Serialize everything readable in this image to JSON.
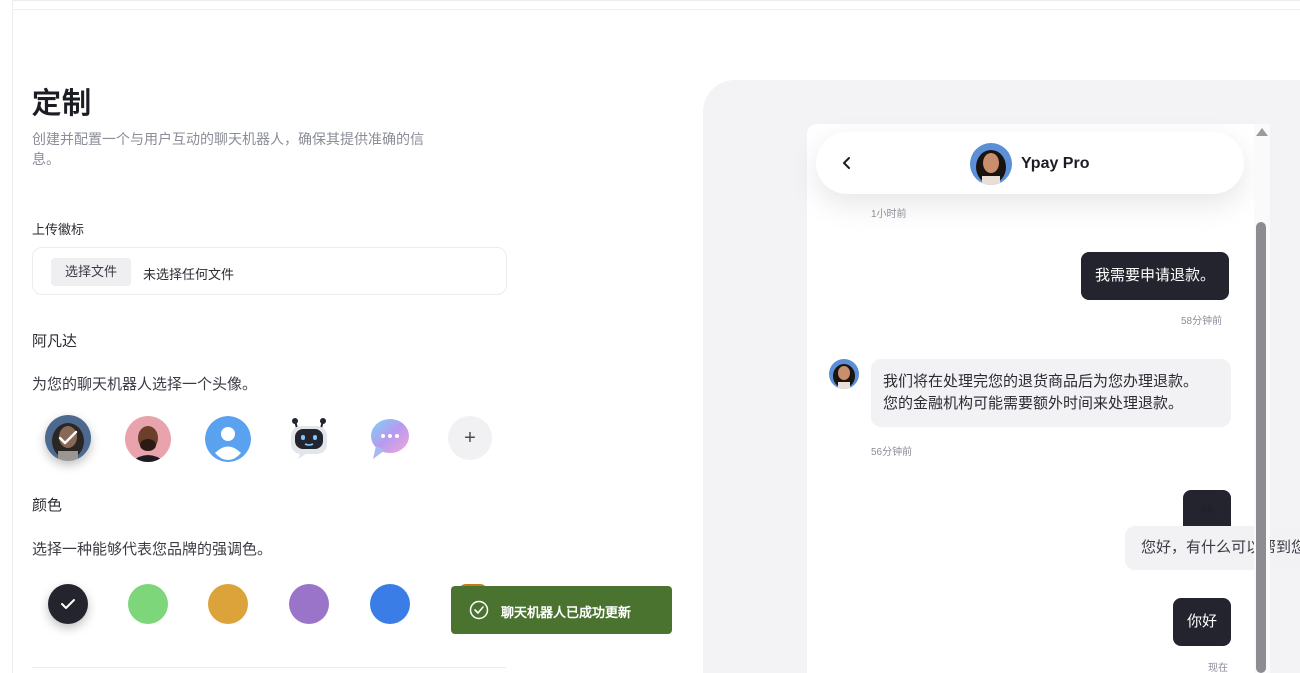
{
  "page": {
    "title": "定制",
    "subtitle": "创建并配置一个与用户互动的聊天机器人，确保其提供准确的信息。"
  },
  "logo_upload": {
    "label": "上传徽标",
    "button_label": "选择文件",
    "file_status": "未选择任何文件"
  },
  "avatar_section": {
    "label": "阿凡达",
    "description": "为您的聊天机器人选择一个头像。",
    "add_label": "+",
    "items": [
      {
        "name": "woman-photo",
        "selected": true
      },
      {
        "name": "man-photo",
        "selected": false
      },
      {
        "name": "default-user-icon",
        "selected": false
      },
      {
        "name": "robot-icon",
        "selected": false
      },
      {
        "name": "chat-bubble-icon",
        "selected": false
      }
    ]
  },
  "color_section": {
    "label": "颜色",
    "description": "选择一种能够代表您品牌的强调色。",
    "swatches": [
      {
        "color": "#24242f",
        "selected": true
      },
      {
        "color": "#7dd67a",
        "selected": false
      },
      {
        "color": "#dba33a",
        "selected": false
      },
      {
        "color": "#9a74c9",
        "selected": false
      },
      {
        "color": "#3a7de6",
        "selected": false
      }
    ]
  },
  "toast": {
    "message": "聊天机器人已成功更新",
    "color": "#4a7330"
  },
  "preview": {
    "bot_name": "Ypay Pro",
    "messages": [
      {
        "role": "time",
        "text": "1小时前"
      },
      {
        "role": "user",
        "text": "我需要申请退款。",
        "time": "58分钟前"
      },
      {
        "role": "bot",
        "lines": [
          "我们将在处理完您的退货商品后为您办理退款。",
          "您的金融机构可能需要额外时间来处理退款。"
        ],
        "time": "56分钟前"
      },
      {
        "role": "user",
        "text": "😳"
      },
      {
        "role": "bot-floating",
        "text": "您好，有什么可以帮到您"
      },
      {
        "role": "user",
        "text": "你好",
        "time": "现在"
      }
    ]
  }
}
